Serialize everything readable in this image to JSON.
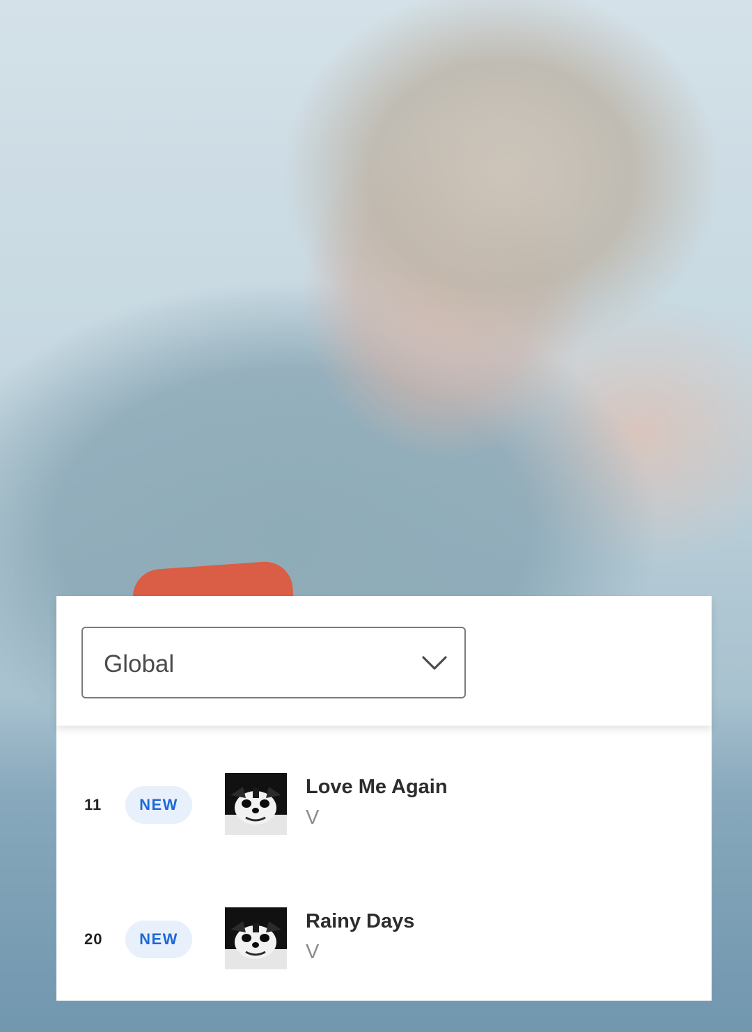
{
  "filter": {
    "selected_region": "Global",
    "chevron_icon": "chevron-down-icon"
  },
  "chart": {
    "rows": [
      {
        "rank": "11",
        "badge": "NEW",
        "title": "Love Me Again",
        "artist": "V",
        "cover_icon": "album-cover"
      },
      {
        "rank": "20",
        "badge": "NEW",
        "title": "Rainy Days",
        "artist": "V",
        "cover_icon": "album-cover"
      }
    ]
  },
  "colors": {
    "badge_bg": "#e8f0fb",
    "badge_text": "#1f68d6",
    "title_text": "#2c2c2c",
    "artist_text": "#8c8c8c"
  }
}
